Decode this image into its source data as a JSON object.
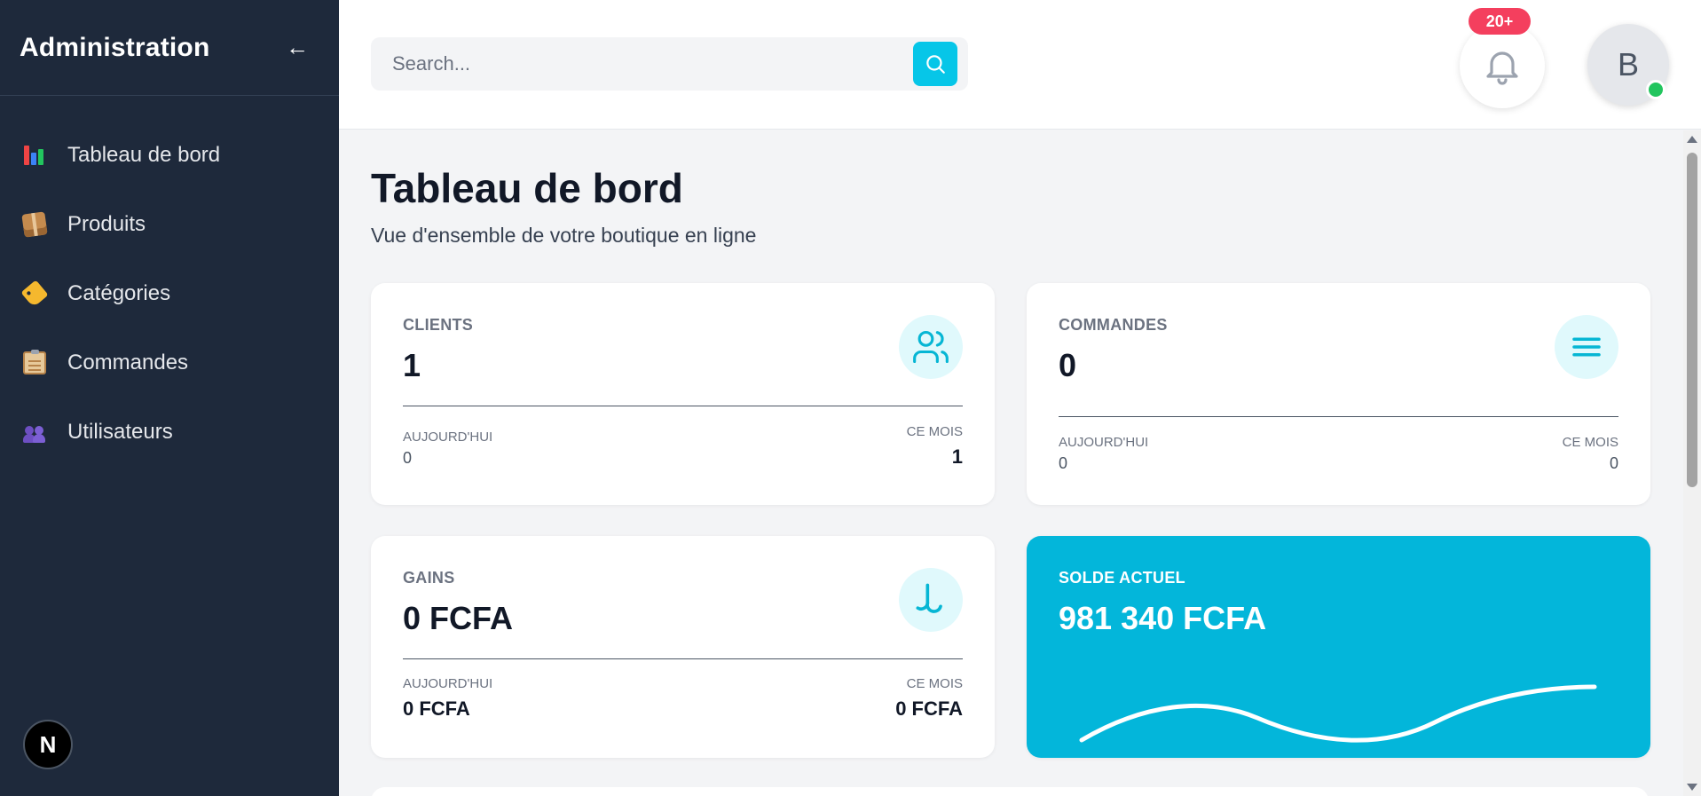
{
  "sidebar": {
    "title": "Administration",
    "collapse_glyph": "←",
    "items": [
      {
        "label": "Tableau de bord",
        "icon": "bar-chart-icon"
      },
      {
        "label": "Produits",
        "icon": "package-icon"
      },
      {
        "label": "Catégories",
        "icon": "tag-icon"
      },
      {
        "label": "Commandes",
        "icon": "clipboard-icon"
      },
      {
        "label": "Utilisateurs",
        "icon": "users-icon"
      }
    ],
    "footer_badge": "N"
  },
  "header": {
    "search_placeholder": "Search...",
    "notification_count": "20+",
    "avatar_initial": "B"
  },
  "page": {
    "title": "Tableau de bord",
    "subtitle": "Vue d'ensemble de votre boutique en ligne"
  },
  "cards": {
    "clients": {
      "label": "CLIENTS",
      "value": "1",
      "today_label": "AUJOURD'HUI",
      "today_value": "0",
      "month_label": "CE MOIS",
      "month_value": "1"
    },
    "orders": {
      "label": "COMMANDES",
      "value": "0",
      "today_label": "AUJOURD'HUI",
      "today_value": "0",
      "month_label": "CE MOIS",
      "month_value": "0"
    },
    "earnings": {
      "label": "GAINS",
      "value": "0 FCFA",
      "today_label": "AUJOURD'HUI",
      "today_value": "0 FCFA",
      "month_label": "CE MOIS",
      "month_value": "0 FCFA"
    },
    "balance": {
      "label": "SOLDE ACTUEL",
      "value": "981 340 FCFA"
    }
  },
  "colors": {
    "sidebar_bg": "#1e293b",
    "accent": "#06c6e8",
    "balance_card": "#03b6da",
    "notification_badge": "#f43f5e",
    "online": "#22c55e"
  }
}
